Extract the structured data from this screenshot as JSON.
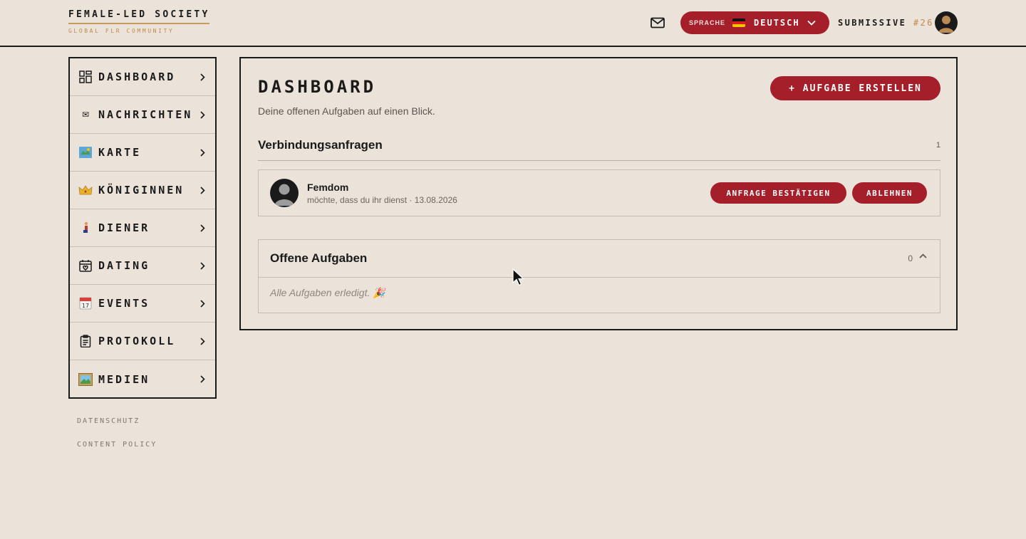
{
  "header": {
    "brand_title": "FEMALE-LED SOCIETY",
    "brand_subtitle": "GLOBAL FLR COMMUNITY",
    "mail_icon": "mail-icon",
    "language": {
      "label": "SPRACHE",
      "flag": "de-flag",
      "value": "DEUTSCH"
    },
    "user": {
      "name": "SUBMISSIVE",
      "number": "#26"
    }
  },
  "sidebar": {
    "items": [
      {
        "label": "DASHBOARD",
        "icon": "grid-icon"
      },
      {
        "label": "NACHRICHTEN",
        "icon": "envelope-icon"
      },
      {
        "label": "KARTE",
        "icon": "map-icon"
      },
      {
        "label": "KÖNIGINNEN",
        "icon": "crown-icon"
      },
      {
        "label": "DIENER",
        "icon": "kneeling-person-icon"
      },
      {
        "label": "DATING",
        "icon": "calendar-heart-icon"
      },
      {
        "label": "EVENTS",
        "icon": "calendar-icon"
      },
      {
        "label": "PROTOKOLL",
        "icon": "clipboard-icon"
      },
      {
        "label": "MEDIEN",
        "icon": "picture-icon"
      }
    ],
    "footer_links": [
      "DATENSCHUTZ",
      "CONTENT POLICY"
    ]
  },
  "main": {
    "title": "DASHBOARD",
    "subtitle": "Deine offenen Aufgaben auf einen Blick.",
    "create_button": "+ AUFGABE ERSTELLEN",
    "requests": {
      "title": "Verbindungsanfragen",
      "count": "1",
      "items": [
        {
          "name": "Femdom",
          "info": "möchte, dass du ihr dienst · 13.08.2026",
          "confirm_label": "ANFRAGE BESTÄTIGEN",
          "reject_label": "ABLEHNEN"
        }
      ]
    },
    "tasks": {
      "title": "Offene Aufgaben",
      "count": "0",
      "empty_text": "Alle Aufgaben erledigt. 🎉"
    }
  },
  "colors": {
    "background": "#ebe3da",
    "accent": "#a51f2b",
    "gold": "#c08a4a",
    "text": "#1a1a1a"
  }
}
